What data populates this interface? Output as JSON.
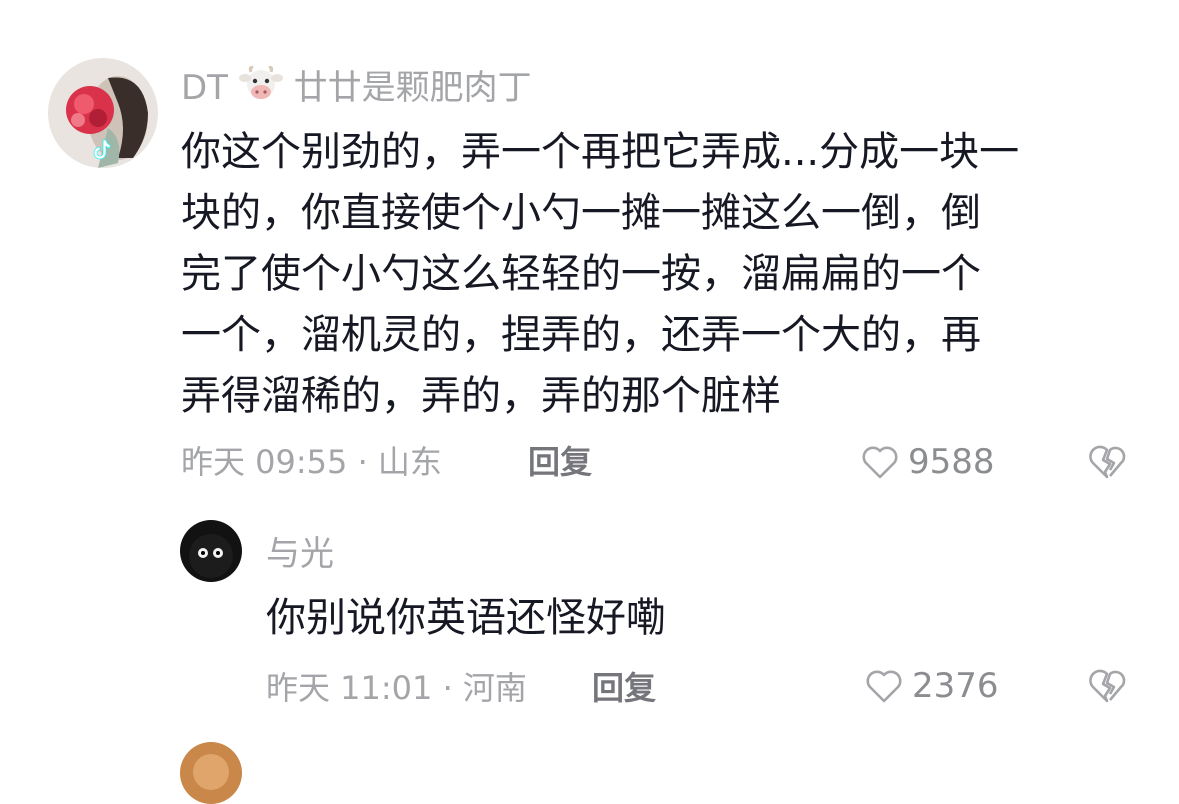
{
  "comments": [
    {
      "username_prefix": "DT",
      "username_emoji": "cow-face-icon",
      "username_suffix": "廿廿是颗肥肉丁",
      "lines": [
        "你这个别劲的，弄一个再把它弄成...分成一块一",
        "块的，你直接使个小勺一摊一摊这么一倒，倒",
        "完了使个小勺这么轻轻的一按，溜扁扁的一个",
        "一个，溜机灵的，捏弄的，还弄一个大的，再",
        "弄得溜稀的，弄的，弄的那个脏样"
      ],
      "meta": "昨天 09:55 · 山东",
      "reply_label": "回复",
      "likes": "9588"
    },
    {
      "username": "与光",
      "lines": [
        "你别说你英语还怪好嘞"
      ],
      "meta": "昨天 11:01 · 河南",
      "reply_label": "回复",
      "likes": "2376"
    }
  ],
  "colors": {
    "primary_text": "#161823",
    "secondary_text": "#a4a5a9",
    "reply_text": "#75767b"
  },
  "icons": {
    "like": "heart-outline-icon",
    "dislike": "broken-heart-icon",
    "platform_badge": "tiktok-badge-icon"
  }
}
